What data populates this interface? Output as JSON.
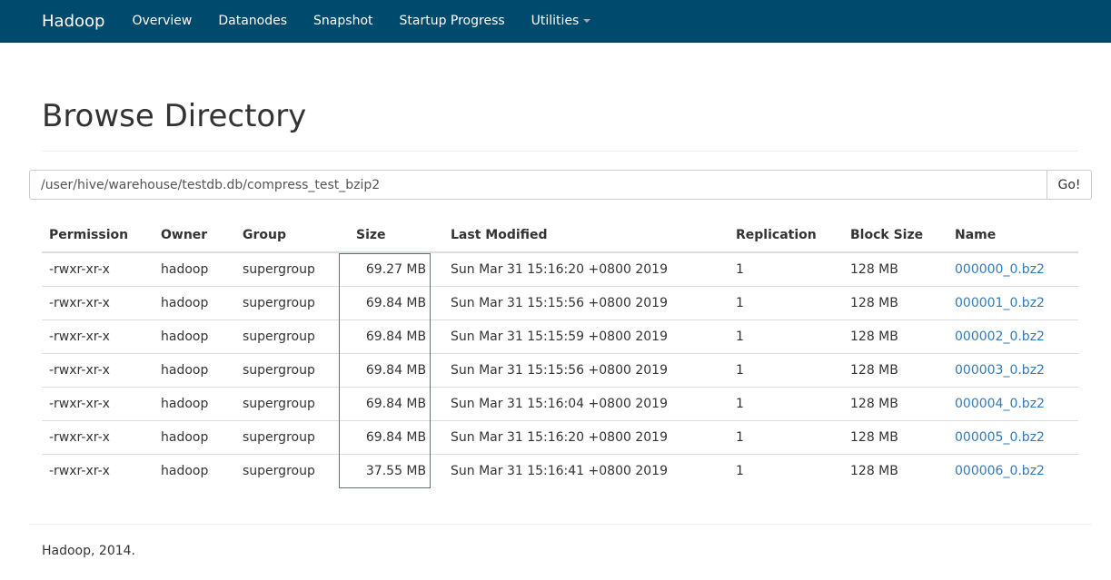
{
  "nav": {
    "brand": "Hadoop",
    "items": [
      "Overview",
      "Datanodes",
      "Snapshot",
      "Startup Progress",
      "Utilities"
    ]
  },
  "page_title": "Browse Directory",
  "path_input": {
    "value": "/user/hive/warehouse/testdb.db/compress_test_bzip2"
  },
  "go_label": "Go!",
  "table": {
    "headers": [
      "Permission",
      "Owner",
      "Group",
      "Size",
      "Last Modified",
      "Replication",
      "Block Size",
      "Name"
    ],
    "rows": [
      [
        "-rwxr-xr-x",
        "hadoop",
        "supergroup",
        "69.27 MB",
        "Sun Mar 31 15:16:20 +0800 2019",
        "1",
        "128 MB",
        "000000_0.bz2"
      ],
      [
        "-rwxr-xr-x",
        "hadoop",
        "supergroup",
        "69.84 MB",
        "Sun Mar 31 15:15:56 +0800 2019",
        "1",
        "128 MB",
        "000001_0.bz2"
      ],
      [
        "-rwxr-xr-x",
        "hadoop",
        "supergroup",
        "69.84 MB",
        "Sun Mar 31 15:15:59 +0800 2019",
        "1",
        "128 MB",
        "000002_0.bz2"
      ],
      [
        "-rwxr-xr-x",
        "hadoop",
        "supergroup",
        "69.84 MB",
        "Sun Mar 31 15:15:56 +0800 2019",
        "1",
        "128 MB",
        "000003_0.bz2"
      ],
      [
        "-rwxr-xr-x",
        "hadoop",
        "supergroup",
        "69.84 MB",
        "Sun Mar 31 15:16:04 +0800 2019",
        "1",
        "128 MB",
        "000004_0.bz2"
      ],
      [
        "-rwxr-xr-x",
        "hadoop",
        "supergroup",
        "69.84 MB",
        "Sun Mar 31 15:16:20 +0800 2019",
        "1",
        "128 MB",
        "000005_0.bz2"
      ],
      [
        "-rwxr-xr-x",
        "hadoop",
        "supergroup",
        "37.55 MB",
        "Sun Mar 31 15:16:41 +0800 2019",
        "1",
        "128 MB",
        "000006_0.bz2"
      ]
    ]
  },
  "footer": "Hadoop, 2014.",
  "colors": {
    "navbar": "#004a6e",
    "link": "#337ab7",
    "annotation": "#e53935"
  }
}
